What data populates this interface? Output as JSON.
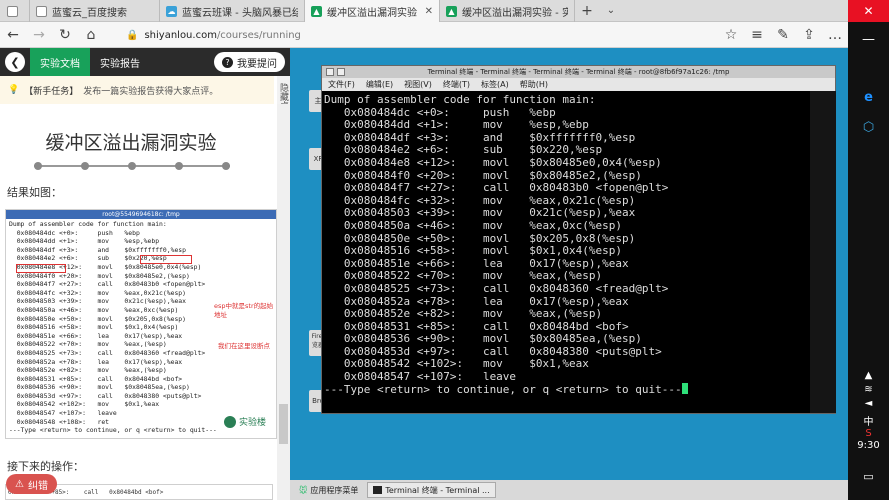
{
  "browser": {
    "tabs": [
      {
        "title": "",
        "icon": "file"
      },
      {
        "title": "蓝蜜云_百度搜索",
        "icon": "file"
      },
      {
        "title": "蓝蜜云班课 - 头脑风暴已结",
        "icon": "cloud"
      },
      {
        "title": "缓冲区溢出漏洞实验 - 实",
        "icon": "lab",
        "active": true
      },
      {
        "title": "缓冲区溢出漏洞实验 - 实验",
        "icon": "lab"
      }
    ],
    "url_domain": "shiyanlou.com",
    "url_path": "/courses/running"
  },
  "lab": {
    "tab_doc": "实验文档",
    "tab_report": "实验报告",
    "ask": "我要提问",
    "tip_tag": "【新手任务】",
    "tip_text": "发布一篇实验报告获得大家点评。",
    "side_hide": "隐藏桌面",
    "title": "缓冲区溢出漏洞实验",
    "result_label": "结果如图：",
    "next_label": "接下来的操作：",
    "error_btn": "纠错",
    "shot_title": "root@5549694618c: /tmp",
    "shot_lines": [
      "Dump of assembler code for function main:",
      "  0x080484dc <+0>:     push   %ebp",
      "  0x080484dd <+1>:     mov    %esp,%ebp",
      "  0x080484df <+3>:     and    $0xfffffff0,%esp",
      "  0x080484e2 <+6>:     sub    $0x220,%esp",
      "  0x080484e8 <+12>:    movl   $0x80485e0,0x4(%esp)",
      "  0x080484f0 <+20>:    movl   $0x80485e2,(%esp)",
      "  0x080484f7 <+27>:    call   0x80483b0 <fopen@plt>",
      "  0x080484fc <+32>:    mov    %eax,0x21c(%esp)",
      "  0x08048503 <+39>:    mov    0x21c(%esp),%eax",
      "  0x0804850a <+46>:    mov    %eax,0xc(%esp)",
      "  0x0804850e <+50>:    movl   $0x205,0x8(%esp)",
      "  0x08048516 <+58>:    movl   $0x1,0x4(%esp)",
      "  0x0804851e <+66>:    lea    0x17(%esp),%eax",
      "  0x08048522 <+70>:    mov    %eax,(%esp)",
      "  0x08048525 <+73>:    call   0x8048360 <fread@plt>",
      "  0x0804852a <+78>:    lea    0x17(%esp),%eax",
      "  0x0804852e <+82>:    mov    %eax,(%esp)",
      "  0x08048531 <+85>:    call   0x80484bd <bof>",
      "  0x08048536 <+90>:    movl   $0x80485ea,(%esp)",
      "  0x0804853d <+97>:    call   0x8048380 <puts@plt>",
      "  0x08048542 <+102>:   mov    $0x1,%eax",
      "  0x08048547 <+107>:   leave",
      "  0x08048548 <+108>:   ret",
      "---Type <return> to continue, or q <return> to quit---"
    ],
    "note1": "esp中就是str的起始地址",
    "note2": "我们在这里设断点",
    "watermark": "实验楼",
    "shot2_line": "0x08048531 <+85>:    call   0x80484bd <bof>"
  },
  "desktop": {
    "icon_labels": [
      "主",
      "XF",
      "Firef 览器",
      "Bro"
    ],
    "terminal": {
      "title": "Terminal 终端 - Terminal 终端 - Terminal 终端 - Terminal 终端 - root@8fb6f97a1c26: /tmp",
      "menu": [
        "文件(F)",
        "编辑(E)",
        "视图(V)",
        "终端(T)",
        "标签(A)",
        "帮助(H)"
      ],
      "lines": [
        "Dump of assembler code for function main:",
        "   0x080484dc <+0>:     push   %ebp",
        "   0x080484dd <+1>:     mov    %esp,%ebp",
        "   0x080484df <+3>:     and    $0xfffffff0,%esp",
        "   0x080484e2 <+6>:     sub    $0x220,%esp",
        "   0x080484e8 <+12>:    movl   $0x80485e0,0x4(%esp)",
        "   0x080484f0 <+20>:    movl   $0x80485e2,(%esp)",
        "   0x080484f7 <+27>:    call   0x80483b0 <fopen@plt>",
        "   0x080484fc <+32>:    mov    %eax,0x21c(%esp)",
        "   0x08048503 <+39>:    mov    0x21c(%esp),%eax",
        "   0x0804850a <+46>:    mov    %eax,0xc(%esp)",
        "   0x0804850e <+50>:    movl   $0x205,0x8(%esp)",
        "   0x08048516 <+58>:    movl   $0x1,0x4(%esp)",
        "   0x0804851e <+66>:    lea    0x17(%esp),%eax",
        "   0x08048522 <+70>:    mov    %eax,(%esp)",
        "   0x08048525 <+73>:    call   0x8048360 <fread@plt>",
        "   0x0804852a <+78>:    lea    0x17(%esp),%eax",
        "   0x0804852e <+82>:    mov    %eax,(%esp)",
        "   0x08048531 <+85>:    call   0x80484bd <bof>",
        "   0x08048536 <+90>:    movl   $0x80485ea,(%esp)",
        "   0x0804853d <+97>:    call   0x8048380 <puts@plt>",
        "   0x08048542 <+102>:   mov    $0x1,%eax",
        "   0x08048547 <+107>:   leave"
      ],
      "prompt": "---Type <return> to continue, or q <return> to quit---"
    },
    "taskbar_menu": "应用程序菜单",
    "taskbar_item": "Terminal 终端 - Terminal ..."
  },
  "system": {
    "lang": "中",
    "time": "9:30"
  },
  "colors": {
    "accent": "#18a15a",
    "desktop": "#1e8fc2",
    "terminal_bg": "#000000"
  }
}
